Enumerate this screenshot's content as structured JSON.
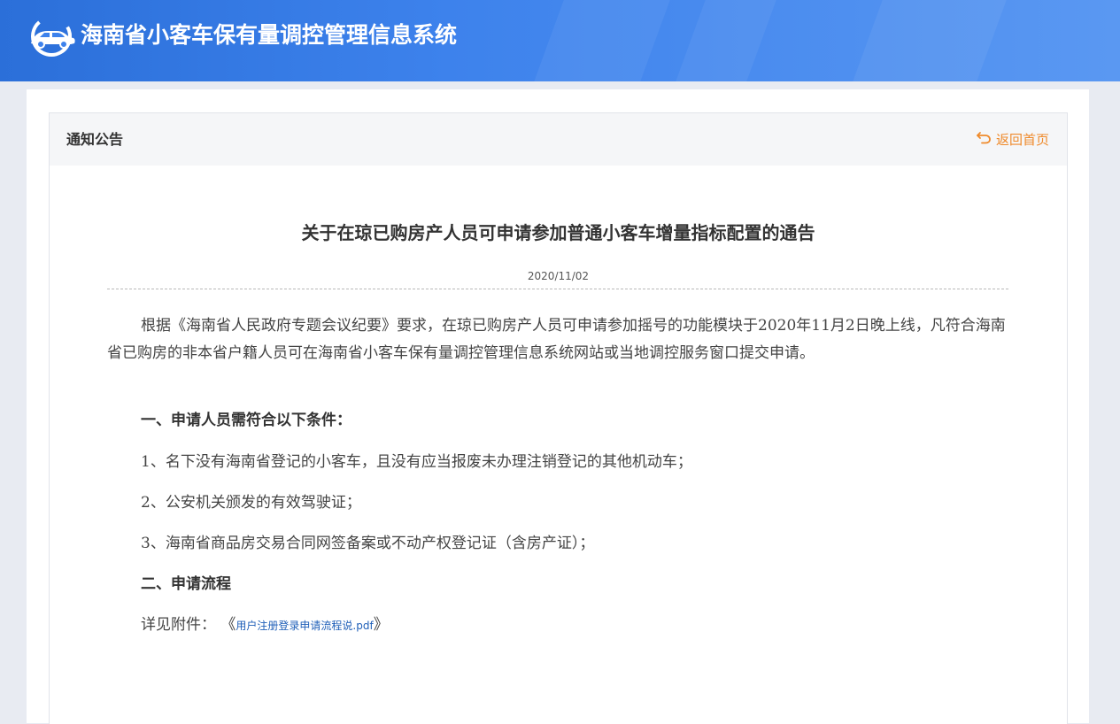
{
  "header": {
    "site_title": "海南省小客车保有量调控管理信息系统",
    "logo_icon": "car-logo-icon"
  },
  "panel": {
    "title": "通知公告",
    "back_home_label": "返回首页",
    "back_icon": "return-arrow-icon"
  },
  "article": {
    "title": "关于在琼已购房产人员可申请参加普通小客车增量指标配置的通告",
    "date": "2020/11/02",
    "intro": "根据《海南省人民政府专题会议纪要》要求，在琼已购房产人员可申请参加摇号的功能模块于2020年11月2日晚上线，凡符合海南省已购房的非本省户籍人员可在海南省小客车保有量调控管理信息系统网站或当地调控服务窗口提交申请。",
    "section1_heading": "一、申请人员需符合以下条件：",
    "condition1": "1、名下没有海南省登记的小客车，且没有应当报废未办理注销登记的其他机动车；",
    "condition2": "2、公安机关颁发的有效驾驶证；",
    "condition3": "3、海南省商品房交易合同网签备案或不动产权登记证（含房产证）；",
    "section2_heading": "二、申请流程",
    "attachment_prefix": "详见附件：",
    "attachment_open": "《",
    "attachment_link": "用户注册登录申请流程说.pdf",
    "attachment_close": "》"
  },
  "colors": {
    "header_blue": "#3d82ec",
    "accent_orange": "#ef8a2b",
    "link_blue": "#1f5fb8"
  }
}
